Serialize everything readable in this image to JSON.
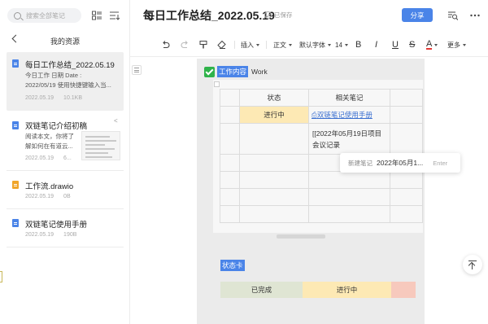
{
  "sidebar": {
    "search_placeholder": "搜索全部笔记",
    "title": "我的资源",
    "notes": [
      {
        "title": "每日工作总结_2022.05.19",
        "line1": "今日工作  日期  Date :",
        "line2": "2022/05/19 使用快捷键输入当...",
        "date": "2022.05.19",
        "size": "10.1KB",
        "icon": "doc-icon",
        "color": "#4a84e8"
      },
      {
        "title": "双链笔记介绍初稿",
        "line1": "阅读本文，你将了",
        "line2": "解如何在有道云...",
        "date": "2022.05.19",
        "size": "6...",
        "icon": "doc-icon",
        "color": "#4a84e8"
      },
      {
        "title": "工作流.drawio",
        "date": "2022.05.19",
        "size": "0B",
        "icon": "drawio-icon",
        "color": "#f0a52a"
      },
      {
        "title": "双链笔记使用手册",
        "date": "2022.05.19",
        "size": "190B",
        "icon": "doc-icon",
        "color": "#4a84e8"
      }
    ]
  },
  "header": {
    "title": "每日工作总结_2022.05.19",
    "saved": "已保存",
    "share": "分享"
  },
  "toolbar": {
    "insert": "插入",
    "paragraph": "正文",
    "font": "默认字体",
    "size": "14",
    "bold": "B",
    "italic": "I",
    "underline": "U",
    "strike": "S",
    "color": "A",
    "more": "更多"
  },
  "doc": {
    "tag": "工作内容",
    "tag_text": "Work",
    "table": {
      "headers": [
        "状态",
        "相关笔记"
      ],
      "row1_status": "进行中",
      "row1_link": "双链笔记使用手册",
      "row2_ref_line1": "[[2022年05月19日项目",
      "row2_ref_line2": "会议记录"
    },
    "popup": {
      "label": "新建笔记",
      "value": "2022年05月1...",
      "key": "Enter"
    },
    "card_tag": "状态卡",
    "cards": [
      "已完成",
      "进行中"
    ]
  },
  "colors": {
    "accent": "#4a84e8",
    "in_progress": "#fde9b4",
    "done": "#dfe5d3",
    "todo": "#f7c9bd",
    "check": "#2fb34a"
  }
}
